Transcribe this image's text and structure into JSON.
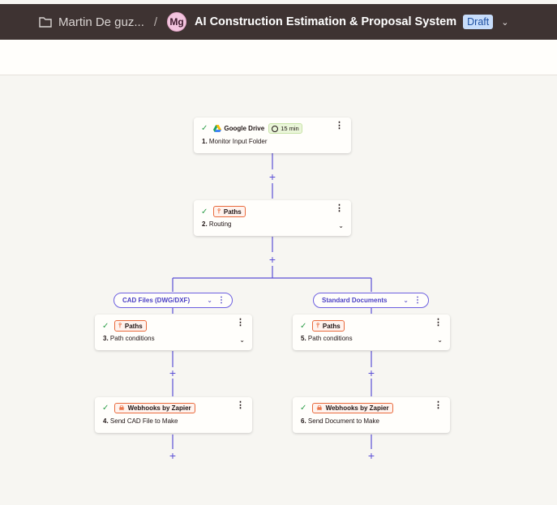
{
  "header": {
    "breadcrumb_folder": "Martin De guz...",
    "separator": "/",
    "avatar_initials": "Mg",
    "zap_title": "AI Construction Estimation & Proposal System",
    "status_badge": "Draft"
  },
  "steps": [
    {
      "app": "Google Drive",
      "time": "15 min",
      "number": "1.",
      "name": "Monitor Input Folder"
    },
    {
      "app": "Paths",
      "number": "2.",
      "name": "Routing"
    },
    {
      "app": "Paths",
      "number": "3.",
      "name": "Path conditions"
    },
    {
      "app": "Webhooks by Zapier",
      "number": "4.",
      "name": "Send CAD File to Make"
    },
    {
      "app": "Paths",
      "number": "5.",
      "name": "Path conditions"
    },
    {
      "app": "Webhooks by Zapier",
      "number": "6.",
      "name": "Send Document to Make"
    }
  ],
  "paths": [
    {
      "label": "CAD Files (DWG/DXF)"
    },
    {
      "label": "Standard Documents"
    }
  ],
  "colors": {
    "topbar": "#3e3332",
    "connector": "#5b4fd6",
    "check": "#2e9e4a",
    "app_chip_border": "#e96a3c",
    "draft_badge": "#c7ddfb"
  }
}
